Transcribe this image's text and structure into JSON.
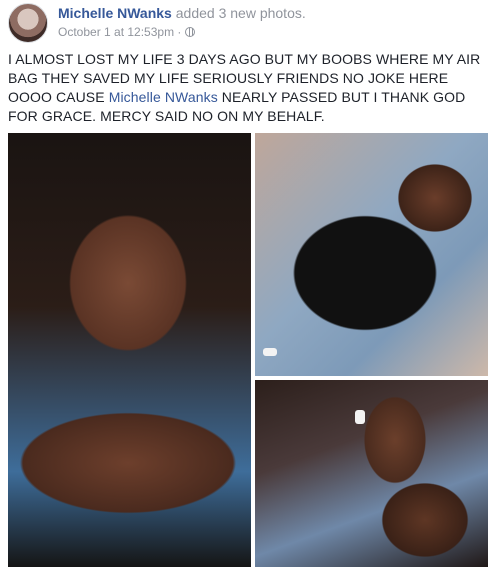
{
  "post": {
    "author": "Michelle NWanks",
    "action": "added 3 new photos.",
    "timestamp": "October 1 at 12:53pm",
    "separator": "·",
    "privacy_icon": "globe-icon",
    "text_part1": "I ALMOST LOST MY LIFE 3 DAYS AGO BUT MY BOOBS WHERE MY AIR BAG THEY SAVED MY LIFE SERIOUSLY FRIENDS NO JOKE HERE OOOO CAUSE ",
    "mention": "Michelle NWanks",
    "text_part2": " NEARLY PASSED BUT I THANK GOD FOR GRACE. MERCY SAID NO ON MY BEHALF."
  },
  "colors": {
    "link": "#365899",
    "meta": "#90949c",
    "text": "#1d2129"
  }
}
